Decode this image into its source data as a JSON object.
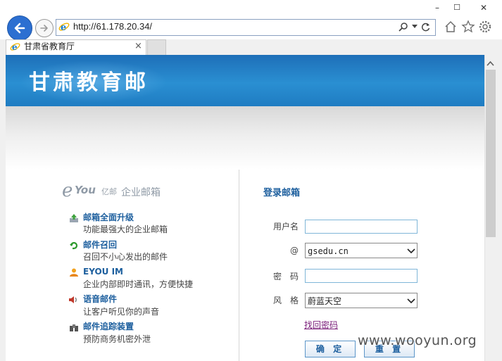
{
  "browser": {
    "url": "http://61.178.20.34/",
    "tab_title": "甘肃省教育厅",
    "tab_close": "×",
    "window_controls": {
      "minimize": "–",
      "maximize": "☐",
      "close": "✕"
    },
    "icons": [
      "back-icon",
      "forward-icon",
      "ie-logo-icon",
      "search-icon",
      "dropdown-icon",
      "refresh-icon",
      "home-icon",
      "favorites-star-icon",
      "settings-gear-icon"
    ]
  },
  "page": {
    "banner_title": "甘肃教育邮",
    "logo": {
      "e": "e",
      "you": "You",
      "cn": "亿邮",
      "subtitle": "企业邮箱"
    },
    "features": [
      {
        "icon": "upgrade-icon",
        "title": "邮箱全面升级",
        "desc": "功能最强大的企业邮箱"
      },
      {
        "icon": "recall-icon",
        "title": "邮件召回",
        "desc": "召回不小心发出的邮件"
      },
      {
        "icon": "im-user-icon",
        "title": "EYOU IM",
        "desc": "企业内部即时通讯，方便快捷"
      },
      {
        "icon": "speaker-icon",
        "title": "语音邮件",
        "desc": "让客户听见你的声音"
      },
      {
        "icon": "tracking-icon",
        "title": "邮件追踪装置",
        "desc": "预防商务机密外泄"
      }
    ],
    "login": {
      "title": "登录邮箱",
      "username_label": "用户名",
      "username_value": "",
      "domain_label": "@",
      "domain_value": "gsedu.cn",
      "password_label": "密　码",
      "password_value": "",
      "style_label": "风　格",
      "style_value": "蔚蓝天空",
      "forgot_link": "找回密码",
      "confirm_button": "确 定",
      "reset_button": "重 置"
    },
    "watermark": "www.wooyun.org"
  },
  "colors": {
    "banner": "#2a8fd2",
    "link": "#1d5f9e",
    "visited": "#7a1e7a",
    "input_border": "#7fb6d8"
  }
}
